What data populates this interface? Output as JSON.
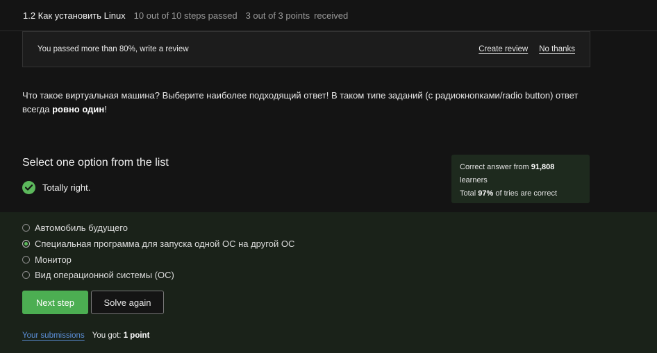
{
  "header": {
    "lesson": "1.2 Как установить Linux",
    "steps": "10 out of 10 steps passed",
    "points": "3 out of 3 points",
    "points_suffix": "received"
  },
  "banner": {
    "message": "You passed more than 80%, write a review",
    "create_review": "Create review",
    "no_thanks": "No thanks"
  },
  "question": {
    "text_before": "Что такое виртуальная машина? Выберите наиболее подходящий ответ! В таком типе заданий (с радиокнопками/radio button) ответ всегда ",
    "text_bold": "ровно один",
    "text_after": "!"
  },
  "quiz": {
    "title": "Select one option from the list",
    "result": "Totally right."
  },
  "stats": {
    "line1_prefix": "Correct answer from ",
    "learners_count": "91,808",
    "line1_suffix": "learners",
    "line2_prefix": "Total ",
    "percent": "97%",
    "line2_suffix": " of tries are correct"
  },
  "options": [
    {
      "label": "Автомобиль будущего",
      "selected": false
    },
    {
      "label": "Специальная программа для запуска одной ОС на другой ОС",
      "selected": true
    },
    {
      "label": "Монитор",
      "selected": false
    },
    {
      "label": "Вид операционной системы (ОС)",
      "selected": false
    }
  ],
  "actions": {
    "next_step": "Next step",
    "solve_again": "Solve again"
  },
  "footer": {
    "submissions_link": "Your submissions",
    "you_got": "You got: ",
    "score": "1 point"
  },
  "colors": {
    "accent_green": "#4cae52",
    "link_blue": "#5b8ed6"
  }
}
